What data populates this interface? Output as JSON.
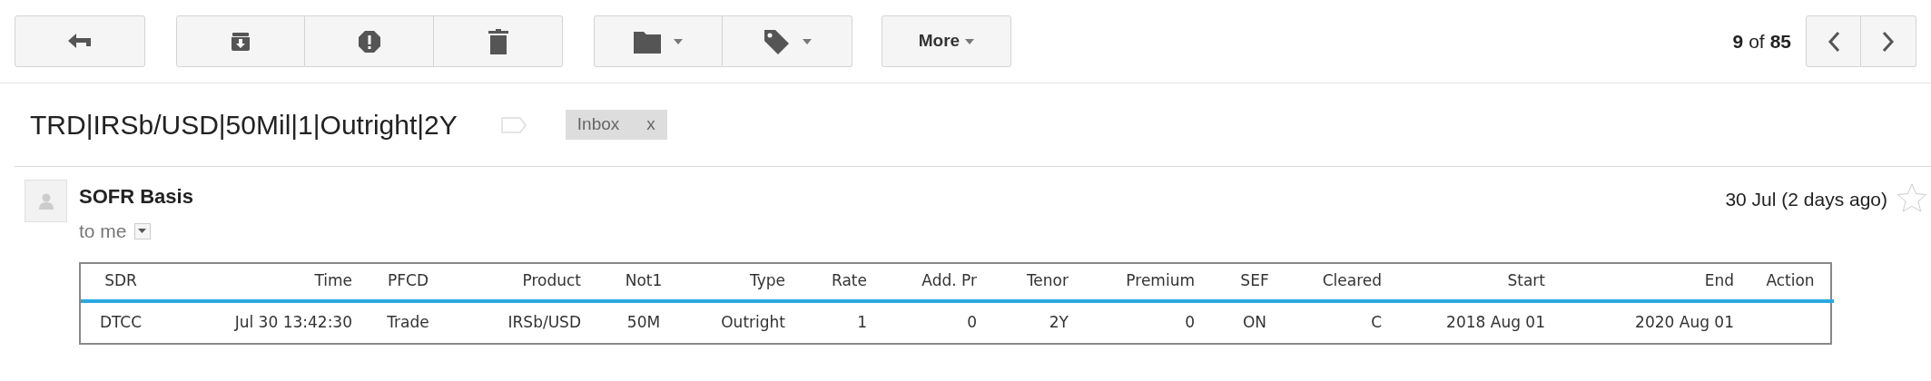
{
  "toolbar": {
    "more_button": "More",
    "pagination": {
      "current": "9",
      "separator": "of",
      "total": "85"
    }
  },
  "subject": {
    "title": "TRD|IRSb/USD|50Mil|1|Outright|2Y",
    "labels": [
      {
        "name": "Inbox",
        "remove": "x"
      }
    ]
  },
  "message": {
    "sender": "SOFR Basis",
    "recipient": "to me",
    "date": "30 Jul (2 days ago)",
    "starred": false,
    "table": {
      "columns": [
        "SDR",
        "Time",
        "PFCD",
        "Product",
        "Not1",
        "Type",
        "Rate",
        "Add. Pr",
        "Tenor",
        "Premium",
        "SEF",
        "Cleared",
        "Start",
        "End",
        "Action"
      ],
      "rows": [
        [
          "DTCC",
          "Jul 30 13:42:30",
          "Trade",
          "IRSb/USD",
          "50M",
          "Outright",
          "1",
          "0",
          "2Y",
          "0",
          "ON",
          "C",
          "2018 Aug 01",
          "2020 Aug 01",
          ""
        ]
      ]
    }
  }
}
